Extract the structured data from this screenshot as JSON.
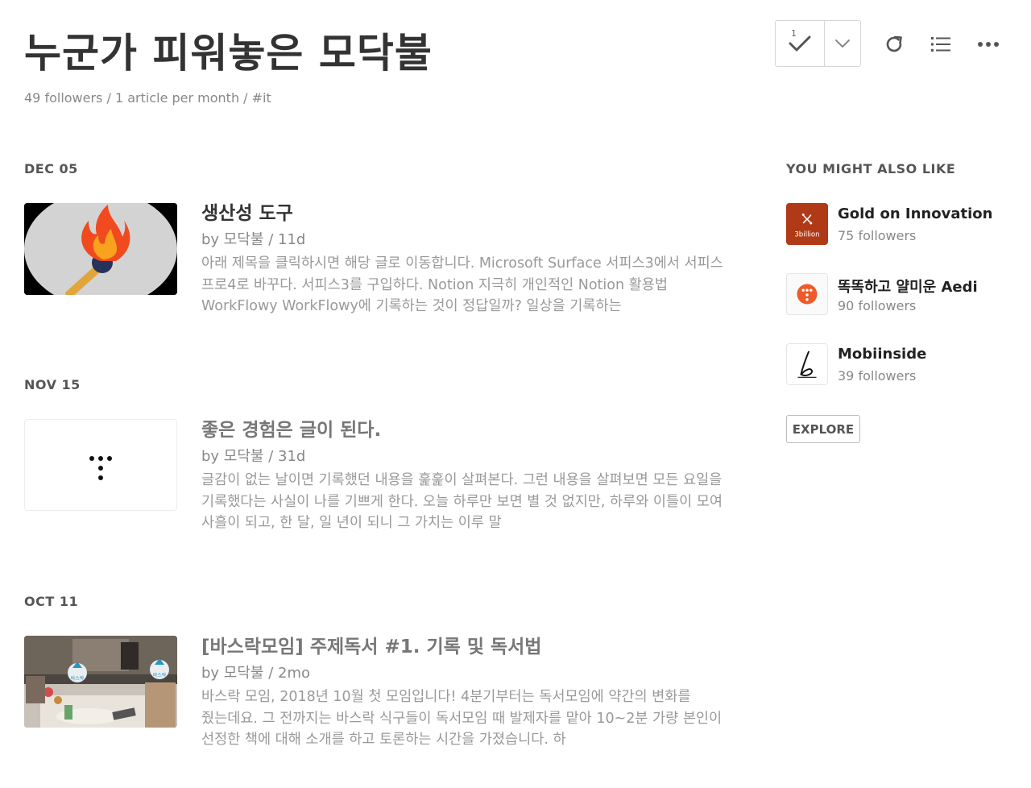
{
  "header": {
    "title": "누군가 피워놓은 모닥불",
    "meta": "49 followers / 1 article per month / #it"
  },
  "toolbar": {
    "check_count": "1",
    "icons": [
      "check-icon",
      "chevron-down-icon",
      "refresh-icon",
      "list-icon",
      "more-icon"
    ]
  },
  "articles": [
    {
      "date": "DEC 05",
      "title": "생산성 도구",
      "byline": "by 모닥불 / 11d",
      "excerpt": "아래 제목을 클릭하시면 해당 글로 이동합니다. Microsoft Surface 서피스3에서 서피스 프로4로 바꾸다. 서피스3를 구입하다. Notion 지극히 개인적인 Notion 활용법 WorkFlowy WorkFlowy에 기록하는 것이 정답일까? 일상을 기록하는",
      "thumbnail": "match-flame-illustration"
    },
    {
      "date": "NOV 15",
      "title": "좋은 경험은 글이 된다.",
      "byline": "by 모닥불 / 31d",
      "excerpt": "글감이 없는 날이면 기록했던 내용을 훑훑이 살펴본다. 그런 내용을 살펴보면 모든 요일을 기록했다는 사실이 나를 기쁘게 한다. 오늘 하루만 보면 별 것 없지만, 하루와 이틀이 모여 사흘이 되고, 한 달, 일 년이 되니 그 가치는 이루 말",
      "thumbnail": "dots-logo"
    },
    {
      "date": "OCT 11",
      "title": "[바스락모임] 주제독서 #1. 기록 및 독서법",
      "byline": "by 모닥불 / 2mo",
      "excerpt": "바스락 모임, 2018년 10월 첫 모임입니다! 4분기부터는 독서모임에 약간의 변화를 줬는데요. 그 전까지는 바스락 식구들이 독서모임 때 발제자를 맡아 10~2분 가량 본인이 선정한 책에 대해 소개를 하고 토론하는 시간을 가졌습니다. 하",
      "thumbnail": "meeting-photo",
      "photo_badge": "바스락"
    }
  ],
  "sidebar": {
    "title": "YOU MIGHT ALSO LIKE",
    "items": [
      {
        "name": "Gold on Innovation",
        "followers": "75 followers",
        "logo_text": "3billion",
        "logo_color": "#b03a17"
      },
      {
        "name": "똑똑하고 얄미운 Aedi",
        "followers": "90 followers",
        "logo_color": "#ee5a2a"
      },
      {
        "name": "Mobiinside",
        "followers": "39 followers"
      }
    ],
    "explore_label": "EXPLORE"
  }
}
